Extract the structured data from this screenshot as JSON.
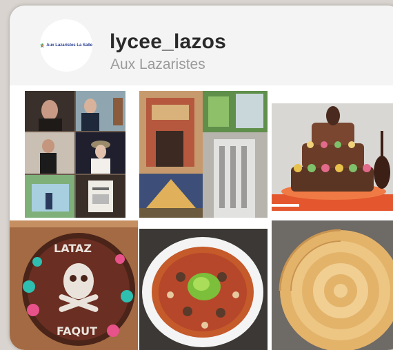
{
  "profile": {
    "username": "lycee_lazos",
    "location": "Aux Lazaristes",
    "logo_text": "Aux Lazaristes La Salle",
    "logo_icon": "star-logo-icon"
  },
  "posts": [
    {
      "name": "post-photo-collage-people"
    },
    {
      "name": "post-photo-architecture"
    },
    {
      "name": "post-photo-tiered-cake"
    },
    {
      "name": "post-photo-decorated-cake"
    },
    {
      "name": "post-photo-pizza"
    },
    {
      "name": "post-photo-apple-tart"
    }
  ],
  "colors": {
    "card_background": "#f4f4f4",
    "username": "#2a2a2a",
    "location": "#9a9a9a"
  }
}
